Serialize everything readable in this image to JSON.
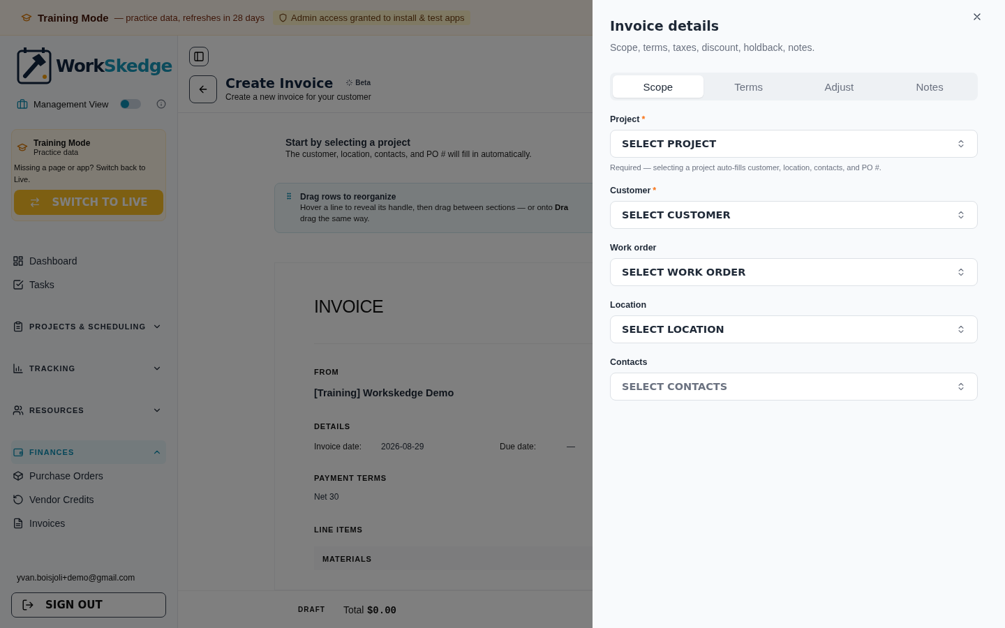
{
  "banner": {
    "title": "Training Mode",
    "note": "— practice data, refreshes in 28 days",
    "admin": "Admin access granted to install & test apps"
  },
  "sidebar": {
    "logo": [
      "Work",
      "Skedge"
    ],
    "view_toggle": {
      "label": "Management View",
      "on": false
    },
    "training_card": {
      "title": "Training Mode",
      "subtitle": "Practice data",
      "message": "Missing a page or app? Switch back to Live.",
      "button": "SWITCH TO LIVE"
    },
    "items": [
      {
        "kind": "link",
        "label": "Dashboard"
      },
      {
        "kind": "link",
        "label": "Tasks"
      },
      {
        "kind": "section",
        "label": "PROJECTS & SCHEDULING",
        "expanded": false,
        "selected": false
      },
      {
        "kind": "section",
        "label": "TRACKING",
        "expanded": false,
        "selected": false
      },
      {
        "kind": "section",
        "label": "RESOURCES",
        "expanded": false,
        "selected": false
      },
      {
        "kind": "section",
        "label": "FINANCES",
        "expanded": true,
        "selected": true,
        "children": [
          {
            "label": "Purchase Orders"
          },
          {
            "label": "Vendor Credits"
          },
          {
            "label": "Invoices"
          }
        ]
      }
    ],
    "user_email": "yvan.boisjoli+demo@gmail.com",
    "sign_out": "SIGN OUT"
  },
  "main": {
    "header": {
      "title": "Create Invoice",
      "badge": "Beta",
      "subtitle": "Create a new invoice for your customer"
    },
    "intro": {
      "title": "Start by selecting a project",
      "text": "The customer, location, contacts, and PO # will fill in automatically."
    },
    "notice": {
      "title": "Drag rows to reorganize",
      "lines": [
        "Hover a line to reveal its handle, then drag between sections — or onto **Dra**",
        "drag the same way."
      ]
    },
    "invoice": {
      "heading": "INVOICE",
      "from_label": "FROM",
      "from": "[Training] Workskedge Demo",
      "details_label": "DETAILS",
      "details": [
        {
          "label": "Invoice date:",
          "value": "2026-08-29"
        },
        {
          "label": "Due date:",
          "value": "—"
        }
      ],
      "terms_label": "PAYMENT TERMS",
      "terms": "Net 30",
      "items_label": "LINE ITEMS",
      "group": "MATERIALS"
    },
    "footer": {
      "status": "DRAFT",
      "total_label": "Total",
      "total": "$0.00"
    }
  },
  "drawer": {
    "title": "Invoice details",
    "subtitle": "Scope, terms, taxes, discount, holdback, notes.",
    "tabs": [
      {
        "label": "Scope",
        "selected": true
      },
      {
        "label": "Terms",
        "selected": false
      },
      {
        "label": "Adjust",
        "selected": false
      },
      {
        "label": "Notes",
        "selected": false
      }
    ],
    "fields": [
      {
        "label": "Project",
        "required_mark": "*",
        "value": "SELECT PROJECT",
        "helper": "Required — selecting a project auto-fills customer, location, contacts, and PO #."
      },
      {
        "label": "Customer",
        "required_mark": "*",
        "value": "SELECT CUSTOMER"
      },
      {
        "label": "Work order",
        "value": "SELECT WORK ORDER"
      },
      {
        "label": "Location",
        "value": "SELECT LOCATION"
      },
      {
        "label": "Contacts",
        "placeholder": "SELECT CONTACTS"
      }
    ]
  }
}
